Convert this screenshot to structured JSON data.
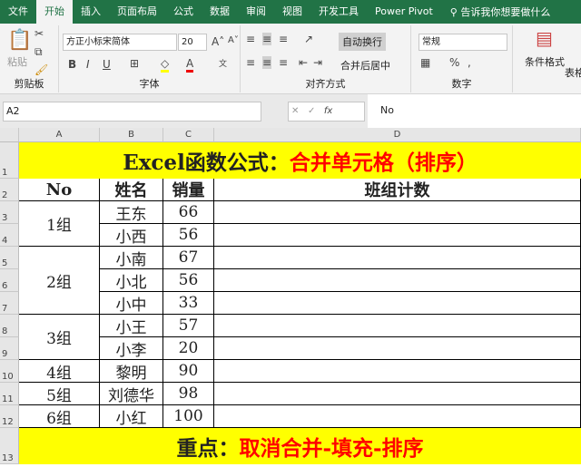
{
  "ribbon_tabs": [
    "文件",
    "开始",
    "插入",
    "页面布局",
    "公式",
    "数据",
    "审阅",
    "视图",
    "开发工具",
    "Power Pivot"
  ],
  "active_tab": "开始",
  "tell_me": "告诉我你想要做什么",
  "clipboard": {
    "paste": "粘贴",
    "label": "剪贴板"
  },
  "font": {
    "name": "方正小标宋简体",
    "size": "20",
    "label": "字体",
    "bold": "B",
    "italic": "I",
    "underline": "U"
  },
  "alignment": {
    "wrap": "自动换行",
    "merge": "合并后居中",
    "label": "对齐方式"
  },
  "number": {
    "format": "常规",
    "label": "数字",
    "percent": "%",
    "comma": ","
  },
  "styles": {
    "conditional": "条件格式",
    "table": "表格"
  },
  "formula_bar": {
    "name_box": "A2",
    "fx": "fx",
    "value": "No"
  },
  "columns": [
    "A",
    "B",
    "C",
    "D"
  ],
  "rows": [
    "1",
    "2",
    "3",
    "4",
    "5",
    "6",
    "7",
    "8",
    "9",
    "10",
    "11",
    "12",
    "13"
  ],
  "title": {
    "black": "Excel函数公式：",
    "red": "合并单元格（排序）"
  },
  "headers": [
    "No",
    "姓名",
    "销量",
    "班组计数"
  ],
  "groups": [
    {
      "label": "1组",
      "rows": 2
    },
    {
      "label": "2组",
      "rows": 3
    },
    {
      "label": "3组",
      "rows": 2
    },
    {
      "label": "4组",
      "rows": 1
    },
    {
      "label": "5组",
      "rows": 1
    },
    {
      "label": "6组",
      "rows": 1
    }
  ],
  "records": [
    [
      "王东",
      "66"
    ],
    [
      "小西",
      "56"
    ],
    [
      "小南",
      "67"
    ],
    [
      "小北",
      "56"
    ],
    [
      "小中",
      "33"
    ],
    [
      "小王",
      "57"
    ],
    [
      "小李",
      "20"
    ],
    [
      "黎明",
      "90"
    ],
    [
      "刘德华",
      "98"
    ],
    [
      "小红",
      "100"
    ]
  ],
  "footer": {
    "black": "重点：",
    "red": "取消合并-填充-排序"
  },
  "colors": {
    "ribbon_green": "#217346",
    "highlight": "#ffff00",
    "accent_red": "#ff0000"
  }
}
